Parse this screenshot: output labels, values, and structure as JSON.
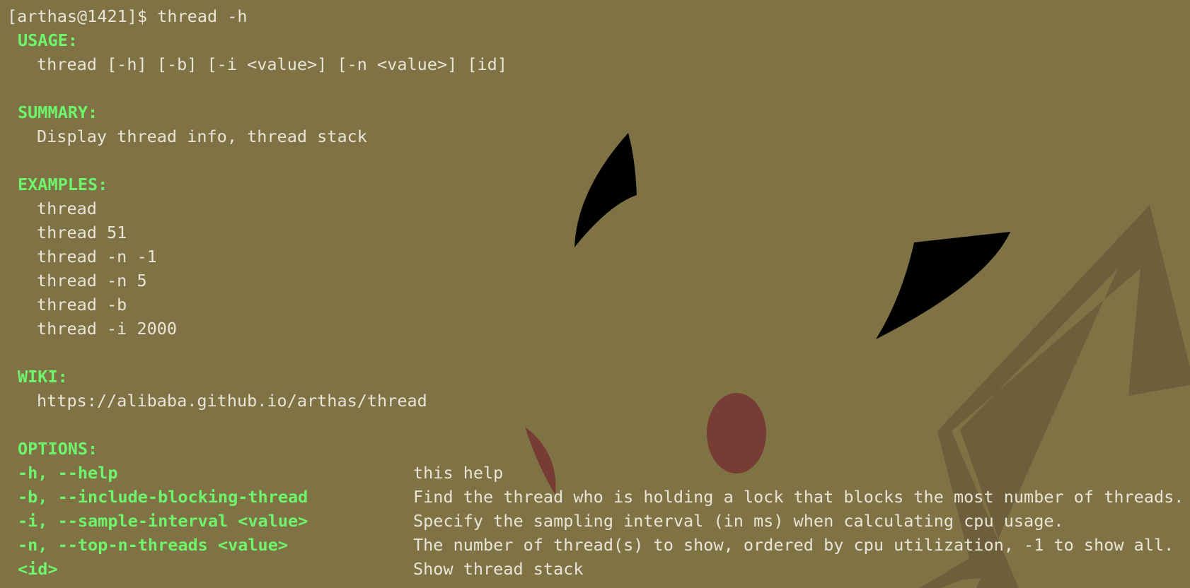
{
  "terminal": {
    "prompt": "[arthas@1421]$ thread -h",
    "usage": {
      "heading": "USAGE:",
      "text": "thread [-h] [-b] [-i <value>] [-n <value>] [id]"
    },
    "summary": {
      "heading": "SUMMARY:",
      "text": "Display thread info, thread stack"
    },
    "examples": {
      "heading": "EXAMPLES:",
      "items": [
        "thread",
        "thread 51",
        "thread -n -1",
        "thread -n 5",
        "thread -b",
        "thread -i 2000"
      ]
    },
    "wiki": {
      "heading": "WIKI:",
      "url": "https://alibaba.github.io/arthas/thread"
    },
    "options": {
      "heading": "OPTIONS:",
      "items": [
        {
          "flag": "-h, --help",
          "desc": "this help"
        },
        {
          "flag": "-b, --include-blocking-thread",
          "desc": "Find the thread who is holding a lock that blocks the most number of threads."
        },
        {
          "flag": "-i, --sample-interval <value>",
          "desc": "Specify the sampling interval (in ms) when calculating cpu usage."
        },
        {
          "flag": "-n, --top-n-threads <value>",
          "desc": "The number of thread(s) to show, ordered by cpu utilization, -1 to show all."
        },
        {
          "flag": "<id>",
          "desc": "Show thread stack"
        }
      ]
    }
  },
  "colors": {
    "background": "#7f7346",
    "heading": "#6ef56b",
    "text": "#e8e4d6"
  }
}
